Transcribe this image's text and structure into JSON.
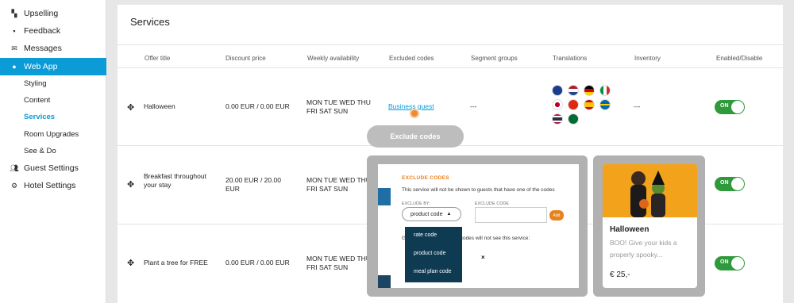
{
  "sidebar": {
    "items": [
      {
        "label": "Upselling",
        "icon": "dashboard-icon"
      },
      {
        "label": "Feedback",
        "icon": "feedback-icon"
      },
      {
        "label": "Messages",
        "icon": "mail-icon"
      },
      {
        "label": "Web App",
        "icon": "user-circle-icon"
      },
      {
        "label": "Styling"
      },
      {
        "label": "Content"
      },
      {
        "label": "Services"
      },
      {
        "label": "Room Upgrades"
      },
      {
        "label": "See & Do"
      },
      {
        "label": "Guest Settings",
        "icon": "users-icon"
      },
      {
        "label": "Hotel Settings",
        "icon": "gear-icon"
      }
    ]
  },
  "main": {
    "title": "Services",
    "columns": [
      "Offer title",
      "Discount price",
      "Weekly availability",
      "Excluded codes",
      "Segment groups",
      "Translations",
      "Inventory",
      "Enabled/Disable"
    ],
    "rows": [
      {
        "title": "Halloween",
        "price": "0.00 EUR / 0.00 EUR",
        "availability": "MON TUE WED THU FRI SAT SUN",
        "excluded": "Business guest",
        "segment": "---",
        "inventory": "---",
        "toggle": "ON"
      },
      {
        "title": "Breakfast throughout your stay",
        "price": "20.00 EUR / 20.00 EUR",
        "availability": "MON TUE WED THU FRI SAT SUN",
        "toggle": "ON"
      },
      {
        "title": "Plant a tree for FREE",
        "price": "0.00 EUR / 0.00 EUR",
        "availability": "MON TUE WED THU FRI SAT SUN",
        "toggle": "ON"
      }
    ]
  },
  "exclude_button": "Exclude codes",
  "modal": {
    "title": "EXCLUDE CODES",
    "description": "This service will not be shown to guests that have one of the codes",
    "exclude_by_label": "EXCLUDE BY:",
    "exclude_code_label": "EXCLUDE CODE",
    "selected": "product code",
    "add": "Add",
    "following_text": "Guests with the following codes will not see this service:",
    "remove_symbol": "×"
  },
  "dropdown": {
    "options": [
      "rate code",
      "product code",
      "meal plan code"
    ]
  },
  "promo": {
    "title": "Halloween",
    "description": "BOO! Give your kids a properly spooky...",
    "price": "€ 25,-"
  },
  "colors": {
    "accent": "#0b9bd7",
    "toggle_on": "#2e9a3c",
    "orange": "#e8821e",
    "dropdown": "#0e3a52"
  }
}
